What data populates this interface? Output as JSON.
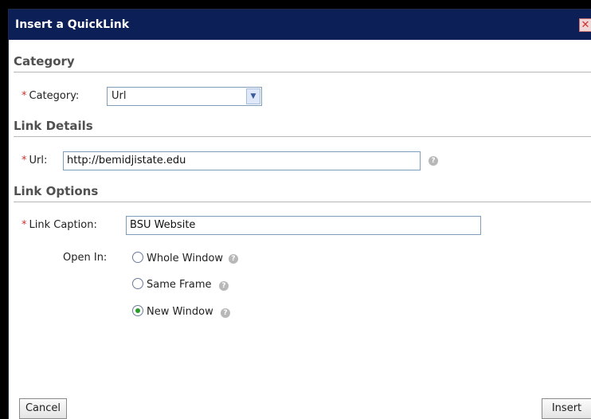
{
  "dialog": {
    "title": "Insert a QuickLink",
    "close_icon": "close-icon",
    "colors": {
      "titlebar": "#0d1f57",
      "required": "#d0302a"
    }
  },
  "sections": {
    "category": "Category",
    "link_details": "Link Details",
    "link_options": "Link Options"
  },
  "fields": {
    "required_marker": "*",
    "category_label": "Category:",
    "category_value": "Url",
    "url_label": "Url:",
    "url_value": "http://bemidjistate.edu",
    "caption_label": "Link Caption:",
    "caption_value": "BSU Website",
    "open_in_label": "Open In:"
  },
  "open_in_options": [
    {
      "label": "Whole Window",
      "checked": false
    },
    {
      "label": "Same Frame",
      "checked": false
    },
    {
      "label": "New Window",
      "checked": true
    }
  ],
  "buttons": {
    "cancel": "Cancel",
    "insert": "Insert"
  }
}
